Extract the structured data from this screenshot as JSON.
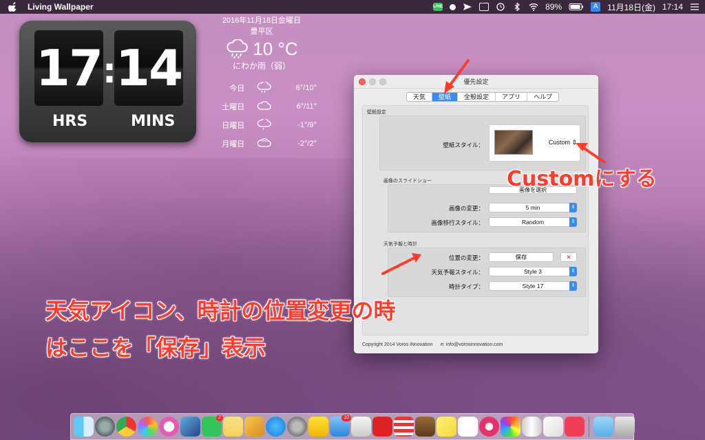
{
  "menubar": {
    "app_name": "Living Wallpaper",
    "battery": "89%",
    "input_indicator": "A",
    "date": "11月18日(金)",
    "time": "17:14",
    "line_label": "LINE"
  },
  "clock": {
    "hours": "17",
    "minutes": "14",
    "separator": ":",
    "hours_label": "HRS",
    "minutes_label": "MINS"
  },
  "weather": {
    "date": "2016年11月18日金曜日",
    "location": "豊平区",
    "current_temp": "10 °C",
    "current_desc": "にわか雨（弱）",
    "forecast": [
      {
        "day": "今日",
        "icon": "rain-cloud-icon",
        "temp": "6°/10°"
      },
      {
        "day": "土曜日",
        "icon": "cloud-icon",
        "temp": "6°/11°"
      },
      {
        "day": "日曜日",
        "icon": "rain-cloud-icon",
        "temp": "-1°/9°"
      },
      {
        "day": "月曜日",
        "icon": "snow-cloud-icon",
        "temp": "-2°/2°"
      }
    ]
  },
  "prefs": {
    "title": "優先設定",
    "tabs": [
      "天気",
      "壁紙",
      "全般設定",
      "アプリ",
      "ヘルプ"
    ],
    "active_tab": "壁紙",
    "wallpaper_section": "壁紙設定",
    "wallpaper_style_label": "壁紙スタイル：",
    "wallpaper_style_value": "Custom",
    "slideshow_section": "画像のスライドショー",
    "select_image_button": "画像を選択",
    "image_change_label": "画像の変更：",
    "image_change_value": "5 min",
    "transition_label": "画像移行スタイル：",
    "transition_value": "Random",
    "weather_clock_section": "天気予報と時計",
    "position_label": "位置の変更：",
    "position_button": "保存",
    "close_x": "✕",
    "forecast_style_label": "天気予報スタイル：",
    "forecast_style_value": "Style 3",
    "clock_type_label": "時計タイプ：",
    "clock_type_value": "Style 17",
    "copyright": "Copyright 2014 Voros iNnovation",
    "email": "e: info@vorosinnovation.com"
  },
  "annotations": {
    "custom_note": "Customにする",
    "position_note_line1": "天気アイコン、時計の位置変更の時",
    "position_note_line2": "はここを「保存」表示"
  },
  "dock": {
    "line_badge": "2",
    "mail_badge": "10",
    "apps": [
      "finder-icon",
      "launchpad-icon",
      "chrome-icon",
      "photos-icon",
      "itunes-icon",
      "preview-icon",
      "line-icon",
      "notes-icon",
      "sketch-icon",
      "app-store-icon",
      "system-preferences-icon",
      "folder-icon",
      "mail-icon",
      "books-icon",
      "reeder-icon",
      "todoist-icon",
      "alfred-icon",
      "stickies-icon",
      "calendar-icon",
      "sketchbook-icon",
      "pinwheel-icon",
      "diet-coke-icon",
      "textedit-icon",
      "pocket-icon"
    ],
    "colors": {
      "accent_red": "#ff3b2e",
      "accent_blue": "#3a8cf0"
    }
  }
}
